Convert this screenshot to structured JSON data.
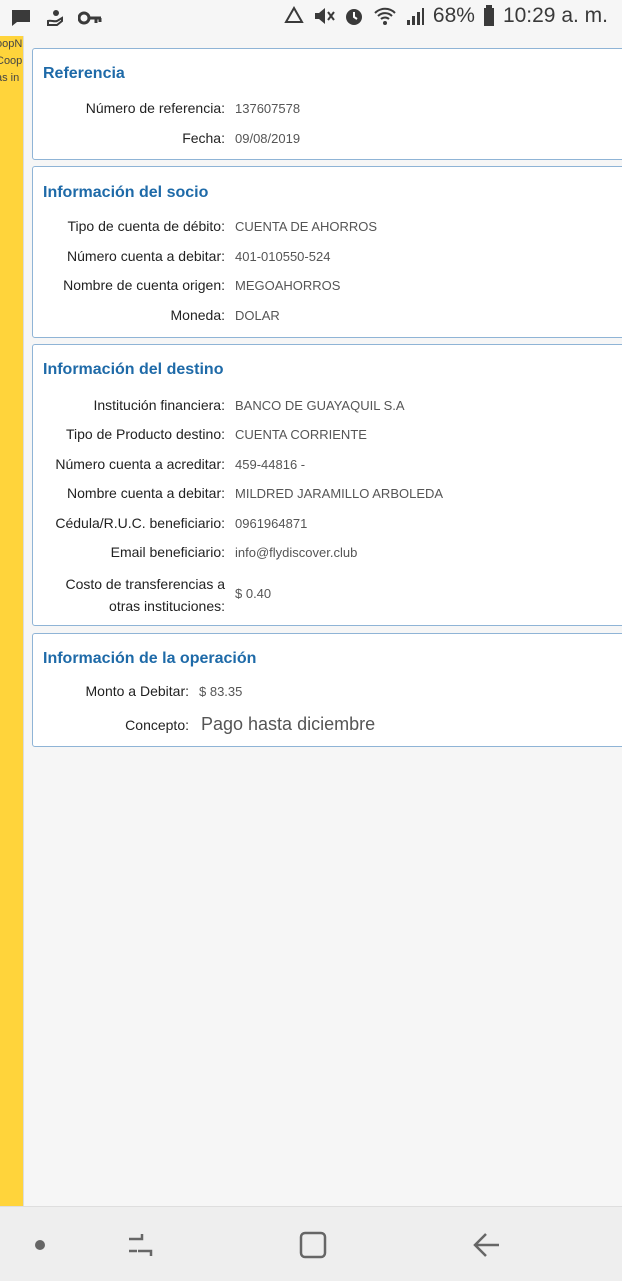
{
  "status_bar": {
    "battery": "68%",
    "time": "10:29 a. m.",
    "left_icons": [
      "message-icon",
      "hand-icon",
      "key-icon"
    ],
    "right_icons": [
      "recycle-icon",
      "mute-icon",
      "alarm-icon",
      "wifi-icon",
      "signal-icon",
      "battery-icon"
    ]
  },
  "side_strip": {
    "lines": [
      "oopN",
      "Coop",
      "as in"
    ]
  },
  "referencia": {
    "title": "Referencia",
    "rows": [
      {
        "label": "Número de referencia:",
        "value": "137607578"
      },
      {
        "label": "Fecha:",
        "value": "09/08/2019"
      }
    ]
  },
  "socio": {
    "title": "Información del socio",
    "rows": [
      {
        "label": "Tipo de cuenta de débito:",
        "value": "CUENTA DE AHORROS"
      },
      {
        "label": "Número cuenta a debitar:",
        "value": "401-010550-524"
      },
      {
        "label": "Nombre de cuenta origen:",
        "value": "MEGOAHORROS"
      },
      {
        "label": "Moneda:",
        "value": "DOLAR"
      }
    ]
  },
  "destino": {
    "title": "Información del destino",
    "rows": [
      {
        "label": "Institución financiera:",
        "value": "BANCO DE GUAYAQUIL S.A"
      },
      {
        "label": "Tipo de Producto destino:",
        "value": "CUENTA CORRIENTE"
      },
      {
        "label": "Número cuenta a acreditar:",
        "value": "459-44816 -"
      },
      {
        "label": "Nombre cuenta a debitar:",
        "value": "MILDRED JARAMILLO ARBOLEDA"
      },
      {
        "label": "Cédula/R.U.C. beneficiario:",
        "value": "0961964871"
      },
      {
        "label": "Email beneficiario:",
        "value": "info@flydiscover.club"
      }
    ],
    "costo": {
      "label_line1": "Costo de transferencias a",
      "label_line2": "otras instituciones:",
      "value": "$ 0.40"
    }
  },
  "operacion": {
    "title": "Información de la operación",
    "monto_label": "Monto a Debitar:",
    "monto_value": "$ 83.35",
    "concepto_label": "Concepto:",
    "concepto_value": "Pago hasta diciembre"
  },
  "nav_bar": {
    "buttons": [
      "dot-icon",
      "recent-apps-icon",
      "home-icon",
      "back-icon"
    ]
  }
}
